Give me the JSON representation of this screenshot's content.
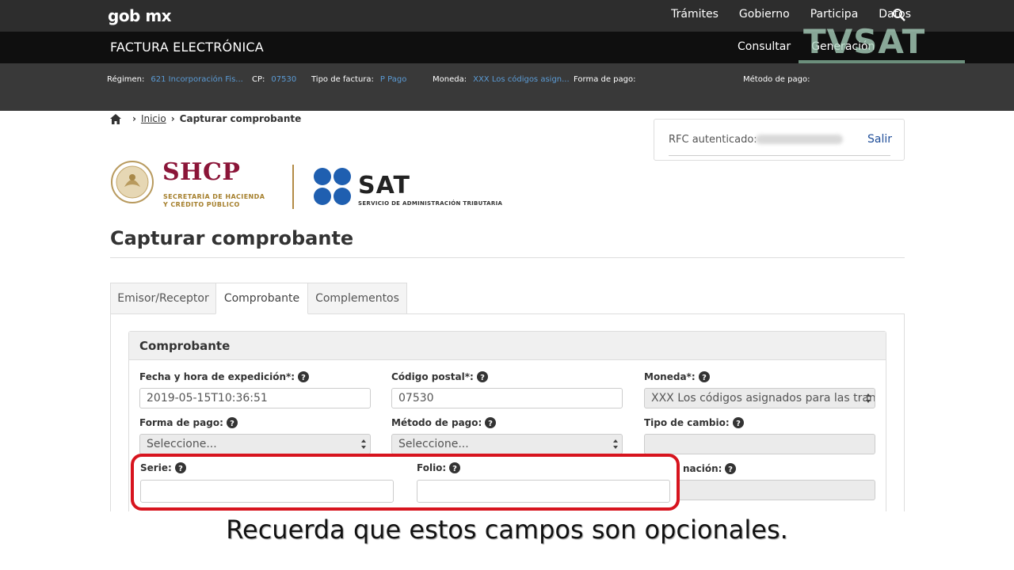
{
  "topbar": {
    "logo": "gob mx",
    "nav": [
      "Trámites",
      "Gobierno",
      "Participa",
      "Datos"
    ]
  },
  "appbar": {
    "title": "FACTURA ELECTRÓNICA",
    "nav": [
      "Consultar",
      "Generación"
    ]
  },
  "watermark": "TVSAT",
  "info": {
    "regimen_label": "Régimen:",
    "regimen_value": "621 Incorporación Fis...",
    "cp_label": "CP:",
    "cp_value": "07530",
    "tipo_label": "Tipo de factura:",
    "tipo_value": "P Pago",
    "moneda_label": "Moneda:",
    "moneda_value": "XXX Los códigos asign...",
    "forma_label": "Forma de pago:",
    "metodo_label": "Método de pago:"
  },
  "breadcrumb": {
    "inicio": "Inicio",
    "current": "Capturar comprobante"
  },
  "rfc": {
    "label": "RFC autenticado:",
    "logout": "Salir"
  },
  "logos": {
    "shcp": "SHCP",
    "shcp_line1": "SECRETARÍA DE HACIENDA",
    "shcp_line2": "Y CRÉDITO PÚBLICO",
    "sat": "SAT",
    "sat_sub": "SERVICIO DE ADMINISTRACIÓN TRIBUTARIA"
  },
  "page_title": "Capturar comprobante",
  "tabs": [
    "Emisor/Receptor",
    "Comprobante",
    "Complementos"
  ],
  "section_title": "Comprobante",
  "fields": {
    "fecha_label": "Fecha y hora de expedición*:",
    "fecha_value": "2019-05-15T10:36:51",
    "cp_label": "Código postal*:",
    "cp_value": "07530",
    "moneda_label": "Moneda*:",
    "moneda_value": "XXX Los códigos asignados para las transacc",
    "forma_label": "Forma de pago:",
    "forma_value": "Seleccione...",
    "metodo_label": "Método de pago:",
    "metodo_value": "Seleccione...",
    "tipo_cambio_label": "Tipo de cambio:",
    "serie_label": "Serie:",
    "folio_label": "Folio:",
    "confirmacion_label": "nación:"
  },
  "caption": "Recuerda que estos campos son opcionales.",
  "colors": {
    "highlight": "#d7141e",
    "link": "#5b9bd5",
    "shcp": "#8b1538",
    "sat_blue": "#1f5fb0"
  }
}
